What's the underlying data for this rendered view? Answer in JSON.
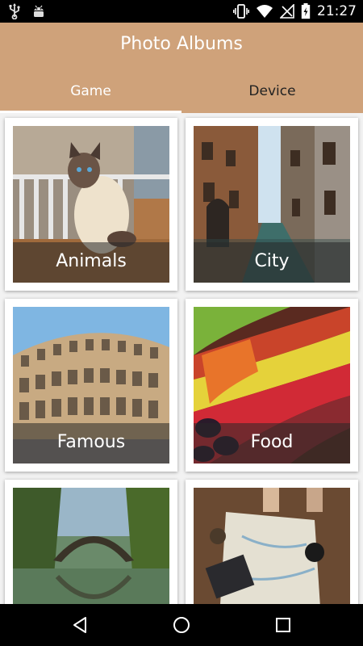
{
  "status_bar": {
    "time": "21:27",
    "icons": [
      "usb-icon",
      "android-icon",
      "vibrate-icon",
      "wifi-icon",
      "no-sim-icon",
      "battery-charging-icon"
    ]
  },
  "header": {
    "title": "Photo Albums"
  },
  "tabs": [
    {
      "label": "Game",
      "active": true
    },
    {
      "label": "Device",
      "active": false
    }
  ],
  "albums": [
    {
      "label": "Animals"
    },
    {
      "label": "City"
    },
    {
      "label": "Famous"
    },
    {
      "label": "Food"
    },
    {
      "label": ""
    },
    {
      "label": ""
    }
  ],
  "nav_bar": {
    "icons": [
      "back-icon",
      "home-icon",
      "recents-icon"
    ]
  },
  "colors": {
    "header_bg": "#cfa27a",
    "active_tab_text": "#ffffff",
    "inactive_tab_text": "#222222"
  }
}
